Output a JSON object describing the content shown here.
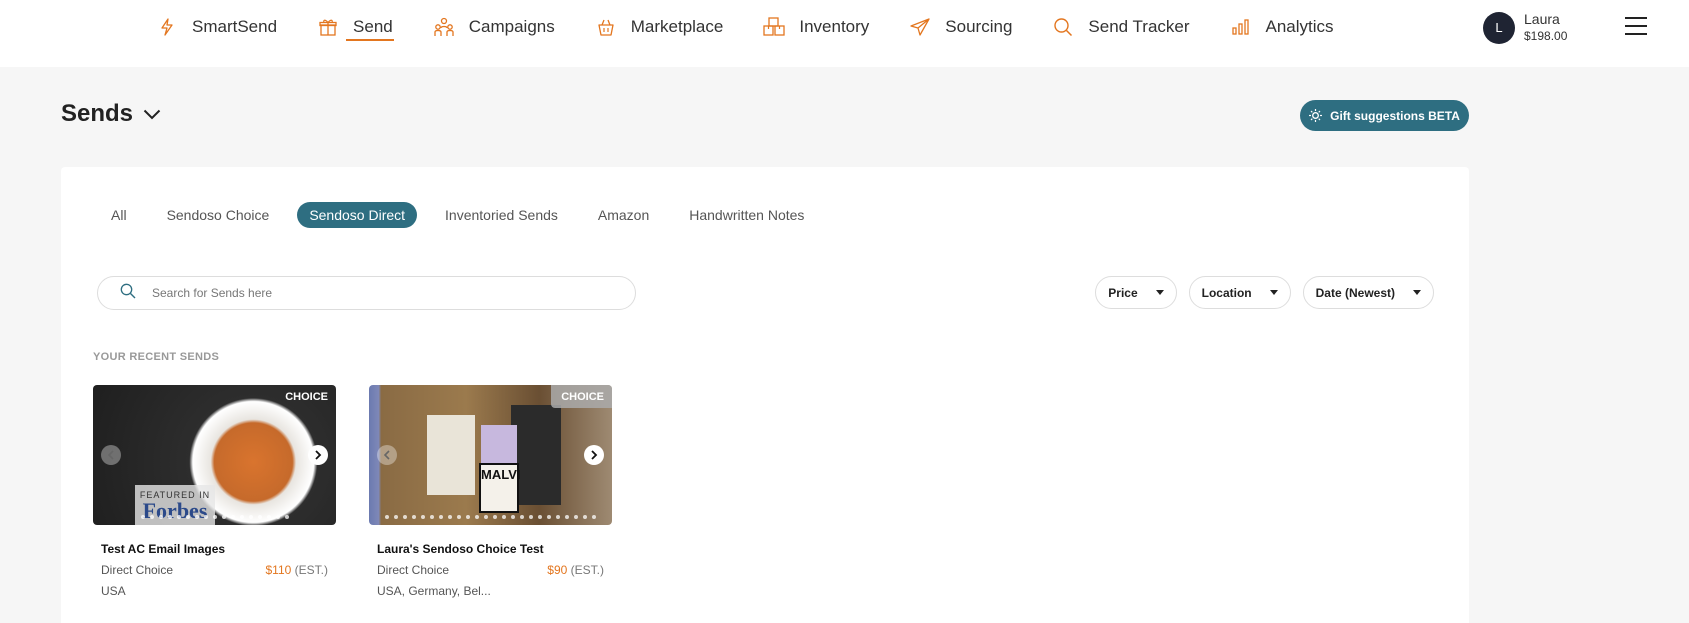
{
  "nav": {
    "items": [
      {
        "label": "SmartSend",
        "icon": "lightning-icon"
      },
      {
        "label": "Send",
        "icon": "gift-icon",
        "active": true
      },
      {
        "label": "Campaigns",
        "icon": "people-icon"
      },
      {
        "label": "Marketplace",
        "icon": "basket-icon"
      },
      {
        "label": "Inventory",
        "icon": "boxes-icon"
      },
      {
        "label": "Sourcing",
        "icon": "paper-plane-icon"
      },
      {
        "label": "Send Tracker",
        "icon": "search-icon"
      },
      {
        "label": "Analytics",
        "icon": "bar-chart-icon"
      }
    ]
  },
  "user": {
    "initial": "L",
    "name": "Laura",
    "balance": "$198.00"
  },
  "page": {
    "title": "Sends"
  },
  "gift_button": {
    "label": "Gift suggestions BETA"
  },
  "tabs": [
    {
      "label": "All"
    },
    {
      "label": "Sendoso Choice"
    },
    {
      "label": "Sendoso Direct",
      "active": true
    },
    {
      "label": "Inventoried Sends"
    },
    {
      "label": "Amazon"
    },
    {
      "label": "Handwritten Notes"
    }
  ],
  "search": {
    "placeholder": "Search for Sends here",
    "value": ""
  },
  "filters": [
    {
      "label": "Price"
    },
    {
      "label": "Location"
    },
    {
      "label": "Date (Newest)"
    }
  ],
  "section": {
    "recent_label": "YOUR RECENT SENDS"
  },
  "cards": [
    {
      "badge": "CHOICE",
      "title": "Test AC Email Images",
      "type": "Direct Choice",
      "price": "$110",
      "est": "(EST.)",
      "locations": "USA",
      "image_text": {
        "line1": "FEATURED IN",
        "line2": "Forbes"
      }
    },
    {
      "badge": "CHOICE",
      "title": "Laura's Sendoso Choice Test",
      "type": "Direct Choice",
      "price": "$90",
      "est": "(EST.)",
      "locations": "USA, Germany, Bel...",
      "image_text": {
        "line1": "MALVI"
      }
    }
  ],
  "colors": {
    "accent": "#e3761f",
    "teal": "#2e6e81",
    "avatar": "#1f2433"
  }
}
